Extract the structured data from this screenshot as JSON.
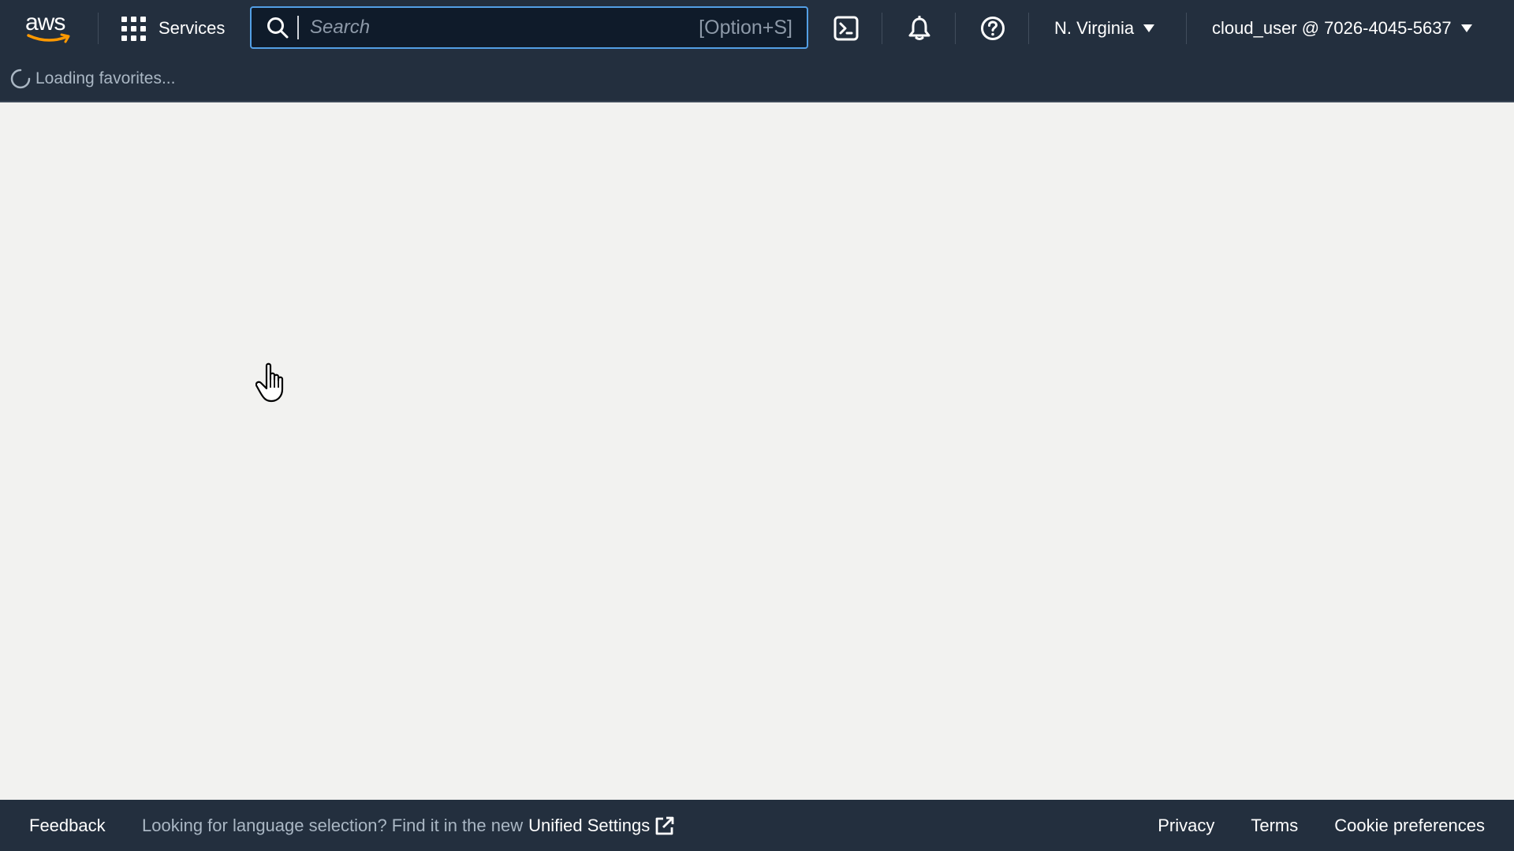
{
  "topnav": {
    "logo_text": "aws",
    "services_label": "Services",
    "search": {
      "placeholder": "Search",
      "shortcut": "[Option+S]"
    },
    "icons": [
      "cloudshell-icon",
      "bell-icon",
      "help-icon"
    ],
    "region_label": "N. Virginia",
    "account_label": "cloud_user @ 7026-4045-5637"
  },
  "favorites": {
    "loading_text": "Loading favorites..."
  },
  "footer": {
    "feedback_label": "Feedback",
    "language_prompt": "Looking for language selection? Find it in the new",
    "unified_settings_label": "Unified Settings",
    "privacy_label": "Privacy",
    "terms_label": "Terms",
    "cookie_label": "Cookie preferences"
  },
  "colors": {
    "nav_background": "#232f3e",
    "search_border": "#539fe5",
    "page_background": "#f2f2f0",
    "logo_accent": "#ff9900"
  }
}
